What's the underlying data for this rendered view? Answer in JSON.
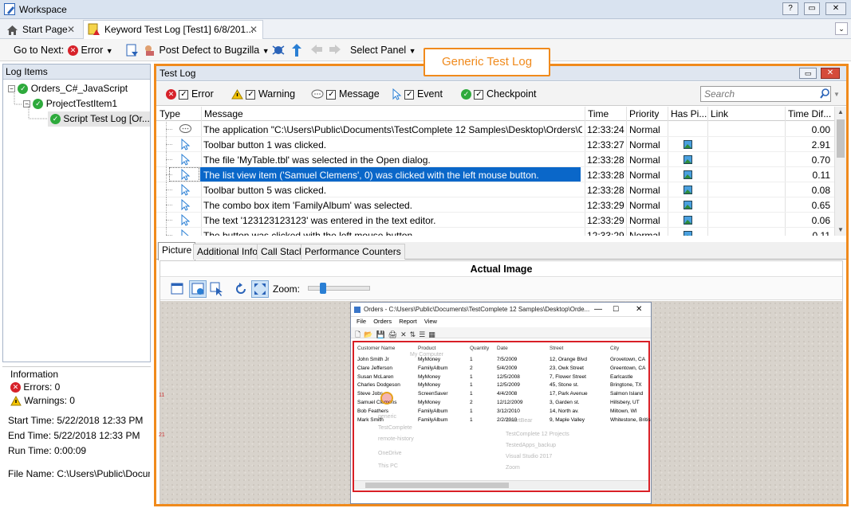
{
  "window": {
    "title": "Workspace",
    "buttons": [
      "?",
      "▭",
      "✕"
    ]
  },
  "tabs": [
    {
      "label": "Start Page"
    },
    {
      "label": "Keyword Test Log [Test1] 6/8/201..."
    }
  ],
  "toolbar": {
    "goto_label": "Go to Next:",
    "error_label": "Error",
    "post_defect_label": "Post Defect to Bugzilla",
    "select_panel_label": "Select Panel"
  },
  "log_items": {
    "title": "Log Items",
    "tree": [
      {
        "label": "Orders_C#_JavaScript"
      },
      {
        "label": "ProjectTestItem1"
      },
      {
        "label": "Script Test Log [Or..."
      }
    ]
  },
  "information": {
    "title": "Information",
    "errors": "Errors: 0",
    "warnings": "Warnings: 0",
    "start_time": "Start Time: 5/22/2018 12:33 PM",
    "end_time": "End Time: 5/22/2018 12:33 PM",
    "run_time": "Run Time: 0:00:09",
    "file_name": "File Name: C:\\Users\\Public\\Documen"
  },
  "callout": "Generic Test Log",
  "test_log": {
    "title": "Test Log",
    "filters": [
      {
        "label": "Error",
        "checked": true
      },
      {
        "label": "Warning",
        "checked": true
      },
      {
        "label": "Message",
        "checked": true
      },
      {
        "label": "Event",
        "checked": true
      },
      {
        "label": "Checkpoint",
        "checked": true
      }
    ],
    "search_placeholder": "Search",
    "columns": [
      "Type",
      "Message",
      "Time",
      "Priority",
      "Has Pi...",
      "Link",
      "Time Dif..."
    ],
    "rows": [
      {
        "type": "message",
        "message": "The application \"C:\\Users\\Public\\Documents\\TestComplete 12 Samples\\Desktop\\Orders\\C#\\bin\\...",
        "time": "12:33:24",
        "priority": "Normal",
        "has_picture": false,
        "diff": "0.00"
      },
      {
        "type": "event",
        "message": "Toolbar button 1 was clicked.",
        "time": "12:33:27",
        "priority": "Normal",
        "has_picture": true,
        "diff": "2.91"
      },
      {
        "type": "event",
        "message": "The file 'MyTable.tbl' was selected in the Open dialog.",
        "time": "12:33:28",
        "priority": "Normal",
        "has_picture": true,
        "diff": "0.70"
      },
      {
        "type": "event",
        "message": "The list view item ('Samuel Clemens', 0) was clicked with the left mouse button.",
        "time": "12:33:28",
        "priority": "Normal",
        "has_picture": true,
        "diff": "0.11",
        "selected": true
      },
      {
        "type": "event",
        "message": "Toolbar button 5 was clicked.",
        "time": "12:33:28",
        "priority": "Normal",
        "has_picture": true,
        "diff": "0.08"
      },
      {
        "type": "event",
        "message": "The combo box item 'FamilyAlbum' was selected.",
        "time": "12:33:29",
        "priority": "Normal",
        "has_picture": true,
        "diff": "0.65"
      },
      {
        "type": "event",
        "message": "The text '123123123123' was entered in the text editor.",
        "time": "12:33:29",
        "priority": "Normal",
        "has_picture": true,
        "diff": "0.06"
      },
      {
        "type": "event",
        "message": "The button was clicked with the left mouse button.",
        "time": "12:33:29",
        "priority": "Normal",
        "has_picture": true,
        "diff": "0.11"
      }
    ]
  },
  "detail_tabs": [
    "Picture",
    "Additional Info",
    "Call Stack",
    "Performance Counters"
  ],
  "picture": {
    "title": "Actual Image",
    "zoom_label": "Zoom:",
    "zoom_level": 0.2,
    "screenshot": {
      "title": "Orders - C:\\Users\\Public\\Documents\\TestComplete 12 Samples\\Desktop\\Orde...",
      "menu": [
        "File",
        "Orders",
        "Report",
        "View"
      ],
      "headers": [
        "Customer Name",
        "Product",
        "Quantity",
        "Date",
        "Street",
        "City"
      ],
      "rows": [
        [
          "John Smith Jr",
          "MyMoney",
          "1",
          "7/5/2009",
          "12, Orange Blvd",
          "Grovetown, CA"
        ],
        [
          "Clare Jefferson",
          "FamilyAlbum",
          "2",
          "5/4/2009",
          "23, Owk Street",
          "Greentown, CA"
        ],
        [
          "Susan McLaren",
          "MyMoney",
          "1",
          "12/5/2008",
          "7, Flower Street",
          "Earlcastle"
        ],
        [
          "Charles Dodgeson",
          "MyMoney",
          "1",
          "12/5/2009",
          "45, Stone st.",
          "Bringtone, TX"
        ],
        [
          "Steve Jobs",
          "ScreenSaver",
          "1",
          "4/4/2008",
          "17, Park Avenue",
          "Salmon Island"
        ],
        [
          "Samuel Clemens",
          "MyMoney",
          "2",
          "12/12/2009",
          "3, Garden st.",
          "Hillsbery, UT"
        ],
        [
          "Bob Feathers",
          "FamilyAlbum",
          "1",
          "3/12/2010",
          "14, North av.",
          "Miltown, WI"
        ],
        [
          "Mark Smith",
          "FamilyAlbum",
          "1",
          "2/2/2010",
          "9, Maple Valley",
          "Whitestone, Britis"
        ]
      ]
    }
  }
}
